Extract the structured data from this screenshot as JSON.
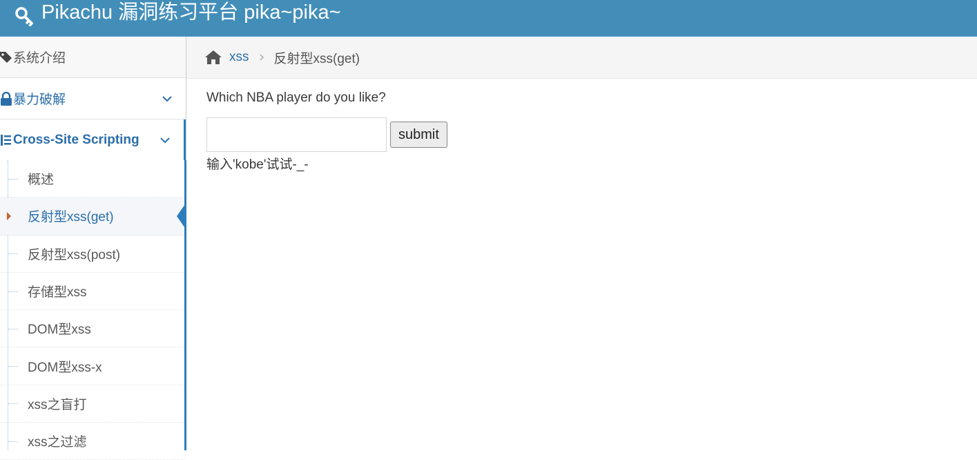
{
  "header": {
    "brand": "Pikachu 漏洞练习平台 pika~pika~",
    "icon": "key-icon",
    "bg_color": "#438eb9"
  },
  "sidebar": {
    "items": [
      {
        "label": "系统介绍",
        "icon": "tags-icon"
      },
      {
        "label": "暴力破解",
        "icon": "lock-icon",
        "expandable": true
      },
      {
        "label": "Cross-Site Scripting",
        "icon": "list-icon",
        "expandable": true,
        "open": true
      }
    ],
    "submenu": [
      {
        "label": "概述"
      },
      {
        "label": "反射型xss(get)",
        "active": true
      },
      {
        "label": "反射型xss(post)"
      },
      {
        "label": "存储型xss"
      },
      {
        "label": "DOM型xss"
      },
      {
        "label": "DOM型xss-x"
      },
      {
        "label": "xss之盲打"
      },
      {
        "label": "xss之过滤"
      }
    ]
  },
  "breadcrumb": {
    "home_icon": "home-icon",
    "link": "xss",
    "current": "反射型xss(get)"
  },
  "main": {
    "question": "Which NBA player do you like?",
    "input_value": "",
    "submit_label": "submit",
    "hint": "输入'kobe'试试-_-"
  }
}
